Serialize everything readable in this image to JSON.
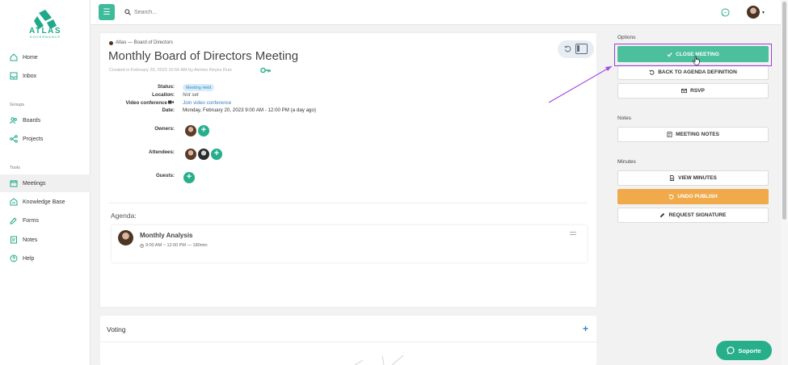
{
  "brand": {
    "name": "ATLAS",
    "tagline": "GOVERNANCE",
    "accent": "#27ae8b"
  },
  "sidebar": {
    "items_top": [
      {
        "label": "Home",
        "icon": "home-icon"
      },
      {
        "label": "Inbox",
        "icon": "inbox-icon"
      }
    ],
    "groups_label": "Groups",
    "groups": [
      {
        "label": "Boards",
        "icon": "users-icon"
      },
      {
        "label": "Projects",
        "icon": "projects-icon"
      }
    ],
    "tools_label": "Tools",
    "tools": [
      {
        "label": "Meetings",
        "icon": "calendar-icon",
        "active": true
      },
      {
        "label": "Knowledge Base",
        "icon": "knowledge-icon"
      },
      {
        "label": "Forms",
        "icon": "forms-icon"
      },
      {
        "label": "Notes",
        "icon": "notes-icon"
      },
      {
        "label": "Help",
        "icon": "help-icon"
      }
    ]
  },
  "topbar": {
    "search_placeholder": "Search..."
  },
  "meeting": {
    "breadcrumb": "Atlas — Board of Directors",
    "title": "Monthly Board of Directors Meeting",
    "created": "Created in February 20, 2023 10:56 AM by Aimme Reyes Ruiz",
    "labels": {
      "status": "Status:",
      "location": "Location:",
      "video": "Video conference",
      "date": "Date:",
      "owners": "Owners:",
      "attendees": "Attendees:",
      "guests": "Guests:"
    },
    "status": "Meeting Held",
    "location": "Not set",
    "video_link": "Join video conference",
    "date": "Monday, February 20, 2023 9:00 AM - 12:00 PM (a day ago)"
  },
  "agenda": {
    "label": "Agenda:",
    "items": [
      {
        "title": "Monthly Analysis",
        "time": "9:00 AM ~ 12:00 PM — 180min"
      }
    ]
  },
  "voting": {
    "title": "Voting",
    "add": "+"
  },
  "options": {
    "label": "Options",
    "close_meeting": "CLOSE MEETING",
    "back_to_agenda": "BACK TO AGENDA DEFINITION",
    "rsvp": "RSVP"
  },
  "notes": {
    "label": "Notes",
    "meeting_notes": "MEETING NOTES"
  },
  "minutes": {
    "label": "Minutes",
    "view_minutes": "VIEW MINUTES",
    "undo_publish": "UNDO PUBLISH",
    "request_signature": "REQUEST SIGNATURE"
  },
  "support": {
    "label": "Soporte"
  }
}
